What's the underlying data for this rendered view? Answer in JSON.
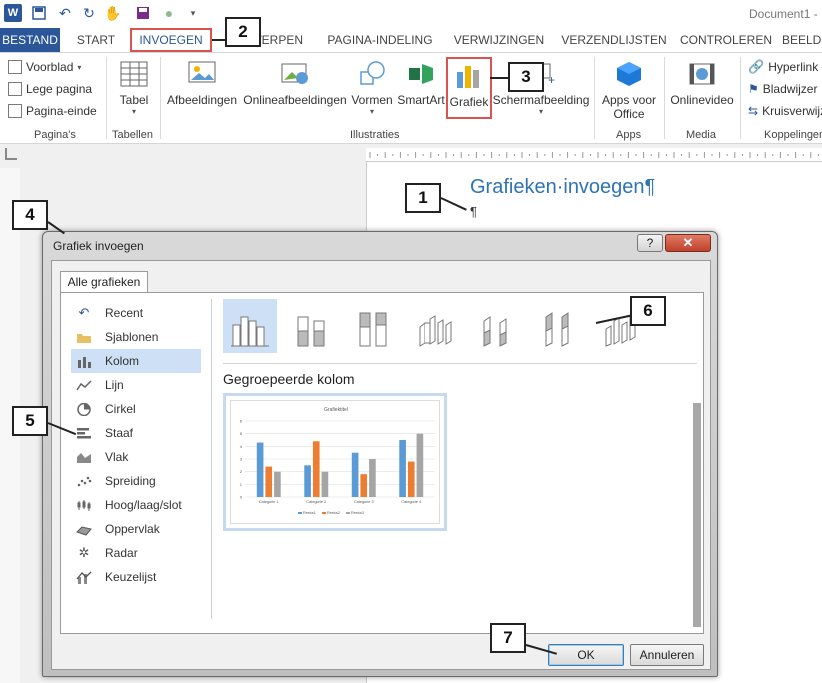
{
  "window": {
    "title": "Document1 -"
  },
  "tabs": [
    {
      "label": "BESTAND"
    },
    {
      "label": "START"
    },
    {
      "label": "INVOEGEN"
    },
    {
      "label": "ONTWERPEN"
    },
    {
      "label": "PAGINA-INDELING"
    },
    {
      "label": "VERWIJZINGEN"
    },
    {
      "label": "VERZENDLIJSTEN"
    },
    {
      "label": "CONTROLEREN"
    },
    {
      "label": "BEELD"
    }
  ],
  "ribbon": {
    "groups": {
      "paginas": "Pagina's",
      "tabellen": "Tabellen",
      "illustraties": "Illustraties",
      "apps": "Apps",
      "media": "Media",
      "koppelingen": "Koppelingen"
    },
    "pages": {
      "voorblad": "Voorblad",
      "lege_pagina": "Lege pagina",
      "pagina_einde": "Pagina-einde"
    },
    "tabel": "Tabel",
    "afbeeldingen": "Afbeeldingen",
    "onlineafbeeldingen": "Onlineafbeeldingen",
    "vormen": "Vormen",
    "smartart": "SmartArt",
    "grafiek": "Grafiek",
    "schermafbeelding": "Schermafbeelding",
    "apps_voor_office": "Apps voor Office",
    "onlinevideo": "Onlinevideo",
    "hyperlink": "Hyperlink",
    "bladwijzer": "Bladwijzer",
    "kruisverwijzing": "Kruisverwijzing"
  },
  "document": {
    "heading": "Grafieken·invoegen¶",
    "paragraph": "¶"
  },
  "dialog": {
    "title": "Grafiek invoegen",
    "help_label": "?",
    "close_label": "✕",
    "tab": "Alle grafieken",
    "categories": [
      {
        "label": "Recent",
        "icon": "undo-icon"
      },
      {
        "label": "Sjablonen",
        "icon": "folder-icon"
      },
      {
        "label": "Kolom",
        "icon": "column-chart-icon"
      },
      {
        "label": "Lijn",
        "icon": "line-chart-icon"
      },
      {
        "label": "Cirkel",
        "icon": "pie-chart-icon"
      },
      {
        "label": "Staaf",
        "icon": "bar-chart-icon"
      },
      {
        "label": "Vlak",
        "icon": "area-chart-icon"
      },
      {
        "label": "Spreiding",
        "icon": "scatter-chart-icon"
      },
      {
        "label": "Hoog/laag/slot",
        "icon": "stock-chart-icon"
      },
      {
        "label": "Oppervlak",
        "icon": "surface-chart-icon"
      },
      {
        "label": "Radar",
        "icon": "radar-chart-icon"
      },
      {
        "label": "Keuzelijst",
        "icon": "combo-chart-icon"
      }
    ],
    "selected_category": "Kolom",
    "subtype_name": "Gegroepeerde kolom",
    "ok": "OK",
    "cancel": "Annuleren"
  },
  "chart_data": {
    "type": "bar",
    "title": "Grafiektitel",
    "categories": [
      "Categorie 1",
      "Categorie 2",
      "Categorie 3",
      "Categorie 4"
    ],
    "series": [
      {
        "name": "Reeks1",
        "values": [
          4.3,
          2.5,
          3.5,
          4.5
        ],
        "color": "#5b9bd5"
      },
      {
        "name": "Reeks2",
        "values": [
          2.4,
          4.4,
          1.8,
          2.8
        ],
        "color": "#ed7d31"
      },
      {
        "name": "Reeks3",
        "values": [
          2,
          2,
          3,
          5
        ],
        "color": "#a5a5a5"
      }
    ],
    "ylim": [
      0,
      6
    ],
    "yticks": [
      "0",
      "1",
      "2",
      "3",
      "4",
      "5",
      "6"
    ],
    "legend": "bottom"
  },
  "callouts": [
    "1",
    "2",
    "3",
    "4",
    "5",
    "6",
    "7"
  ],
  "colors": {
    "accent": "#2b579a",
    "highlight": "#d9534f",
    "selected": "#cde0f5"
  }
}
